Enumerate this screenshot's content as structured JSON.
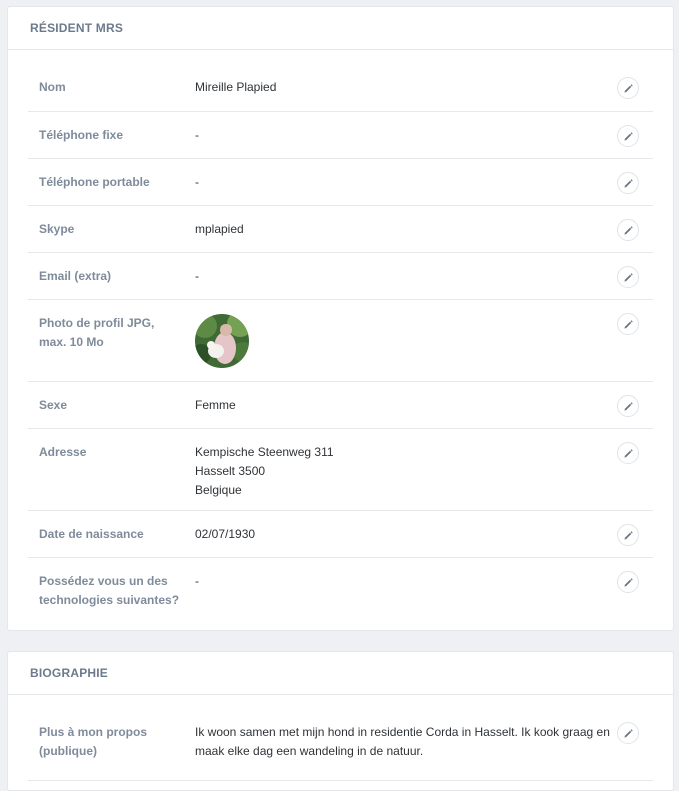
{
  "resident_card": {
    "title": "RÉSIDENT MRS",
    "rows": [
      {
        "label": "Nom",
        "value": "Mireille Plapied"
      },
      {
        "label": "Téléphone fixe",
        "value": "-"
      },
      {
        "label": "Téléphone portable",
        "value": "-"
      },
      {
        "label": "Skype",
        "value": "mplapied"
      },
      {
        "label": "Email (extra)",
        "value": "-"
      },
      {
        "label": "Photo de profil JPG, max. 10 Mo"
      },
      {
        "label": "Sexe",
        "value": "Femme"
      },
      {
        "label": "Adresse",
        "lines": [
          "Kempische Steenweg 311",
          "Hasselt 3500",
          "Belgique"
        ]
      },
      {
        "label": "Date de naissance",
        "value": "02/07/1930"
      },
      {
        "label": "Possédez vous un des technologies suivantes?",
        "value": "-"
      }
    ]
  },
  "bio_card": {
    "title": "BIOGRAPHIE",
    "rows": [
      {
        "label": "Plus à mon propos (publique)",
        "value": "Ik woon samen met mijn hond in residentie Corda in Hasselt. Ik kook graag en maak elke dag een wandeling in de natuur."
      }
    ]
  },
  "icons": {
    "edit": "pencil-icon"
  },
  "colors": {
    "label": "#7f8b9a",
    "header": "#6c7a8c",
    "background": "#eef0f3"
  }
}
